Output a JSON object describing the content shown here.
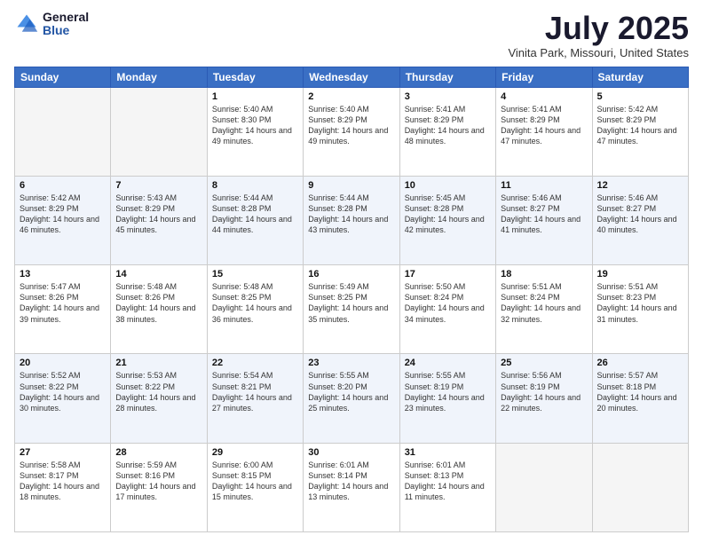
{
  "logo": {
    "general": "General",
    "blue": "Blue"
  },
  "title": "July 2025",
  "location": "Vinita Park, Missouri, United States",
  "days_of_week": [
    "Sunday",
    "Monday",
    "Tuesday",
    "Wednesday",
    "Thursday",
    "Friday",
    "Saturday"
  ],
  "weeks": [
    [
      {
        "day": "",
        "empty": true
      },
      {
        "day": "",
        "empty": true
      },
      {
        "day": "1",
        "sunrise": "5:40 AM",
        "sunset": "8:30 PM",
        "daylight": "14 hours and 49 minutes."
      },
      {
        "day": "2",
        "sunrise": "5:40 AM",
        "sunset": "8:29 PM",
        "daylight": "14 hours and 49 minutes."
      },
      {
        "day": "3",
        "sunrise": "5:41 AM",
        "sunset": "8:29 PM",
        "daylight": "14 hours and 48 minutes."
      },
      {
        "day": "4",
        "sunrise": "5:41 AM",
        "sunset": "8:29 PM",
        "daylight": "14 hours and 47 minutes."
      },
      {
        "day": "5",
        "sunrise": "5:42 AM",
        "sunset": "8:29 PM",
        "daylight": "14 hours and 47 minutes."
      }
    ],
    [
      {
        "day": "6",
        "sunrise": "5:42 AM",
        "sunset": "8:29 PM",
        "daylight": "14 hours and 46 minutes."
      },
      {
        "day": "7",
        "sunrise": "5:43 AM",
        "sunset": "8:29 PM",
        "daylight": "14 hours and 45 minutes."
      },
      {
        "day": "8",
        "sunrise": "5:44 AM",
        "sunset": "8:28 PM",
        "daylight": "14 hours and 44 minutes."
      },
      {
        "day": "9",
        "sunrise": "5:44 AM",
        "sunset": "8:28 PM",
        "daylight": "14 hours and 43 minutes."
      },
      {
        "day": "10",
        "sunrise": "5:45 AM",
        "sunset": "8:28 PM",
        "daylight": "14 hours and 42 minutes."
      },
      {
        "day": "11",
        "sunrise": "5:46 AM",
        "sunset": "8:27 PM",
        "daylight": "14 hours and 41 minutes."
      },
      {
        "day": "12",
        "sunrise": "5:46 AM",
        "sunset": "8:27 PM",
        "daylight": "14 hours and 40 minutes."
      }
    ],
    [
      {
        "day": "13",
        "sunrise": "5:47 AM",
        "sunset": "8:26 PM",
        "daylight": "14 hours and 39 minutes."
      },
      {
        "day": "14",
        "sunrise": "5:48 AM",
        "sunset": "8:26 PM",
        "daylight": "14 hours and 38 minutes."
      },
      {
        "day": "15",
        "sunrise": "5:48 AM",
        "sunset": "8:25 PM",
        "daylight": "14 hours and 36 minutes."
      },
      {
        "day": "16",
        "sunrise": "5:49 AM",
        "sunset": "8:25 PM",
        "daylight": "14 hours and 35 minutes."
      },
      {
        "day": "17",
        "sunrise": "5:50 AM",
        "sunset": "8:24 PM",
        "daylight": "14 hours and 34 minutes."
      },
      {
        "day": "18",
        "sunrise": "5:51 AM",
        "sunset": "8:24 PM",
        "daylight": "14 hours and 32 minutes."
      },
      {
        "day": "19",
        "sunrise": "5:51 AM",
        "sunset": "8:23 PM",
        "daylight": "14 hours and 31 minutes."
      }
    ],
    [
      {
        "day": "20",
        "sunrise": "5:52 AM",
        "sunset": "8:22 PM",
        "daylight": "14 hours and 30 minutes."
      },
      {
        "day": "21",
        "sunrise": "5:53 AM",
        "sunset": "8:22 PM",
        "daylight": "14 hours and 28 minutes."
      },
      {
        "day": "22",
        "sunrise": "5:54 AM",
        "sunset": "8:21 PM",
        "daylight": "14 hours and 27 minutes."
      },
      {
        "day": "23",
        "sunrise": "5:55 AM",
        "sunset": "8:20 PM",
        "daylight": "14 hours and 25 minutes."
      },
      {
        "day": "24",
        "sunrise": "5:55 AM",
        "sunset": "8:19 PM",
        "daylight": "14 hours and 23 minutes."
      },
      {
        "day": "25",
        "sunrise": "5:56 AM",
        "sunset": "8:19 PM",
        "daylight": "14 hours and 22 minutes."
      },
      {
        "day": "26",
        "sunrise": "5:57 AM",
        "sunset": "8:18 PM",
        "daylight": "14 hours and 20 minutes."
      }
    ],
    [
      {
        "day": "27",
        "sunrise": "5:58 AM",
        "sunset": "8:17 PM",
        "daylight": "14 hours and 18 minutes."
      },
      {
        "day": "28",
        "sunrise": "5:59 AM",
        "sunset": "8:16 PM",
        "daylight": "14 hours and 17 minutes."
      },
      {
        "day": "29",
        "sunrise": "6:00 AM",
        "sunset": "8:15 PM",
        "daylight": "14 hours and 15 minutes."
      },
      {
        "day": "30",
        "sunrise": "6:01 AM",
        "sunset": "8:14 PM",
        "daylight": "14 hours and 13 minutes."
      },
      {
        "day": "31",
        "sunrise": "6:01 AM",
        "sunset": "8:13 PM",
        "daylight": "14 hours and 11 minutes."
      },
      {
        "day": "",
        "empty": true
      },
      {
        "day": "",
        "empty": true
      }
    ]
  ]
}
